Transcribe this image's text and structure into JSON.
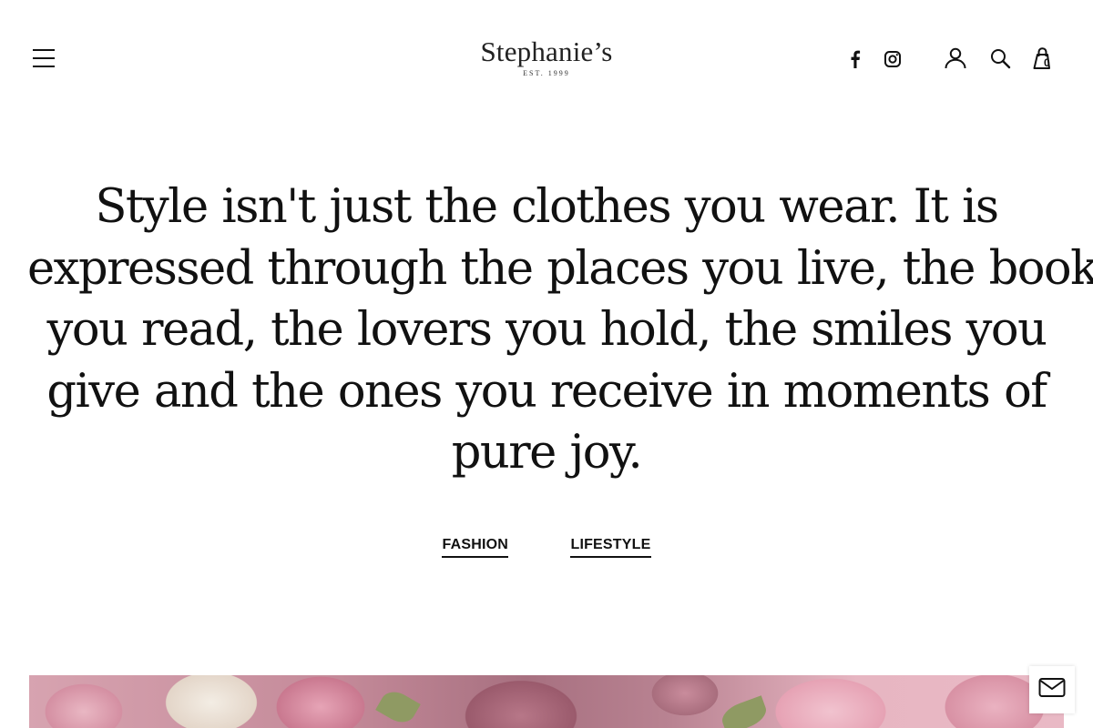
{
  "header": {
    "logo_name": "Stephanie’s",
    "logo_est": "EST. 1999",
    "cart_count": "0",
    "icons": [
      "menu-icon",
      "facebook-icon",
      "instagram-icon",
      "account-icon",
      "search-icon",
      "shopping-bag-icon"
    ]
  },
  "quote": {
    "lines": [
      "Style isn't just the clothes you wear. It is",
      "expressed through the places you live, the books",
      "you read, the lovers you hold, the smiles you",
      "give and the ones you receive in moments of",
      "pure joy."
    ]
  },
  "tags": [
    {
      "label": "FASHION"
    },
    {
      "label": "LIFESTYLE"
    }
  ],
  "floating": {
    "icon": "mail-icon"
  },
  "colors": {
    "text": "#111111",
    "background": "#ffffff",
    "hero_pink": "#d48fa2",
    "hero_mauve": "#9a5a6c"
  }
}
